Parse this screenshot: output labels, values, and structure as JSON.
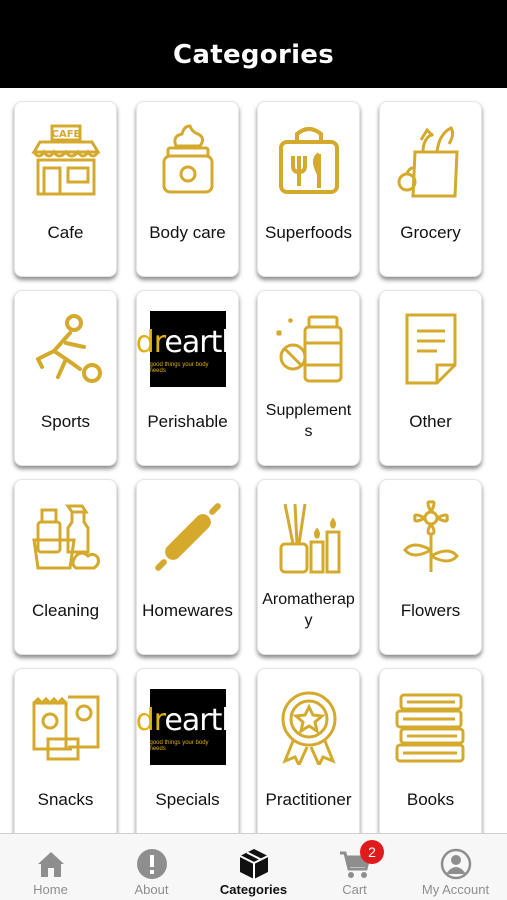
{
  "header": {
    "title": "Categories"
  },
  "colors": {
    "accent": "#D4A92C",
    "header_bg": "#000000",
    "badge": "#E01B1B"
  },
  "categories": [
    {
      "label": "Cafe",
      "icon": "cafe-storefront-icon"
    },
    {
      "label": "Body care",
      "icon": "cream-jar-icon"
    },
    {
      "label": "Superfoods",
      "icon": "food-bag-icon"
    },
    {
      "label": "Grocery",
      "icon": "grocery-bag-icon"
    },
    {
      "label": "Sports",
      "icon": "soccer-player-icon"
    },
    {
      "label": "Perishable",
      "icon": "dr-earth-logo"
    },
    {
      "label": "Supplement\ns",
      "icon": "supplement-bottle-icon"
    },
    {
      "label": "Other",
      "icon": "document-icon"
    },
    {
      "label": "Cleaning",
      "icon": "cleaning-supplies-icon"
    },
    {
      "label": "Homewares",
      "icon": "rolling-pin-icon"
    },
    {
      "label": "Aromatherap\ny",
      "icon": "diffuser-candles-icon"
    },
    {
      "label": "Flowers",
      "icon": "flowers-icon"
    },
    {
      "label": "Snacks",
      "icon": "snack-packs-icon"
    },
    {
      "label": "Specials",
      "icon": "dr-earth-logo"
    },
    {
      "label": "Practitioner",
      "icon": "award-badge-icon"
    },
    {
      "label": "Books",
      "icon": "book-stack-icon"
    }
  ],
  "logo": {
    "word_first": "dr",
    "word_rest": "earth",
    "tagline": "good things your body needs"
  },
  "tabbar": {
    "tabs": [
      {
        "label": "Home",
        "icon": "home-icon"
      },
      {
        "label": "About",
        "icon": "info-icon"
      },
      {
        "label": "Categories",
        "icon": "cube-icon",
        "active": true
      },
      {
        "label": "Cart",
        "icon": "cart-icon"
      },
      {
        "label": "My Account",
        "icon": "account-icon"
      }
    ],
    "cart_badge": "2"
  }
}
